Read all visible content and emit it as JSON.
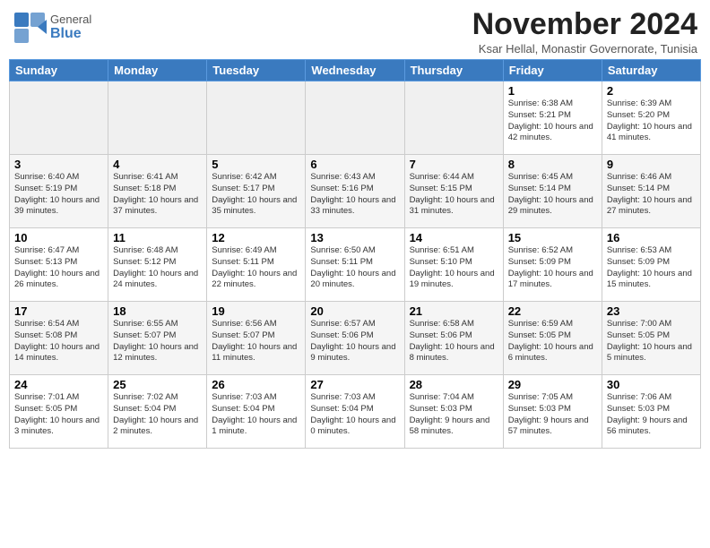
{
  "header": {
    "logo_general": "General",
    "logo_blue": "Blue",
    "month": "November 2024",
    "location": "Ksar Hellal, Monastir Governorate, Tunisia"
  },
  "days_of_week": [
    "Sunday",
    "Monday",
    "Tuesday",
    "Wednesday",
    "Thursday",
    "Friday",
    "Saturday"
  ],
  "weeks": [
    [
      {
        "day": "",
        "info": ""
      },
      {
        "day": "",
        "info": ""
      },
      {
        "day": "",
        "info": ""
      },
      {
        "day": "",
        "info": ""
      },
      {
        "day": "",
        "info": ""
      },
      {
        "day": "1",
        "info": "Sunrise: 6:38 AM\nSunset: 5:21 PM\nDaylight: 10 hours and 42 minutes."
      },
      {
        "day": "2",
        "info": "Sunrise: 6:39 AM\nSunset: 5:20 PM\nDaylight: 10 hours and 41 minutes."
      }
    ],
    [
      {
        "day": "3",
        "info": "Sunrise: 6:40 AM\nSunset: 5:19 PM\nDaylight: 10 hours and 39 minutes."
      },
      {
        "day": "4",
        "info": "Sunrise: 6:41 AM\nSunset: 5:18 PM\nDaylight: 10 hours and 37 minutes."
      },
      {
        "day": "5",
        "info": "Sunrise: 6:42 AM\nSunset: 5:17 PM\nDaylight: 10 hours and 35 minutes."
      },
      {
        "day": "6",
        "info": "Sunrise: 6:43 AM\nSunset: 5:16 PM\nDaylight: 10 hours and 33 minutes."
      },
      {
        "day": "7",
        "info": "Sunrise: 6:44 AM\nSunset: 5:15 PM\nDaylight: 10 hours and 31 minutes."
      },
      {
        "day": "8",
        "info": "Sunrise: 6:45 AM\nSunset: 5:14 PM\nDaylight: 10 hours and 29 minutes."
      },
      {
        "day": "9",
        "info": "Sunrise: 6:46 AM\nSunset: 5:14 PM\nDaylight: 10 hours and 27 minutes."
      }
    ],
    [
      {
        "day": "10",
        "info": "Sunrise: 6:47 AM\nSunset: 5:13 PM\nDaylight: 10 hours and 26 minutes."
      },
      {
        "day": "11",
        "info": "Sunrise: 6:48 AM\nSunset: 5:12 PM\nDaylight: 10 hours and 24 minutes."
      },
      {
        "day": "12",
        "info": "Sunrise: 6:49 AM\nSunset: 5:11 PM\nDaylight: 10 hours and 22 minutes."
      },
      {
        "day": "13",
        "info": "Sunrise: 6:50 AM\nSunset: 5:11 PM\nDaylight: 10 hours and 20 minutes."
      },
      {
        "day": "14",
        "info": "Sunrise: 6:51 AM\nSunset: 5:10 PM\nDaylight: 10 hours and 19 minutes."
      },
      {
        "day": "15",
        "info": "Sunrise: 6:52 AM\nSunset: 5:09 PM\nDaylight: 10 hours and 17 minutes."
      },
      {
        "day": "16",
        "info": "Sunrise: 6:53 AM\nSunset: 5:09 PM\nDaylight: 10 hours and 15 minutes."
      }
    ],
    [
      {
        "day": "17",
        "info": "Sunrise: 6:54 AM\nSunset: 5:08 PM\nDaylight: 10 hours and 14 minutes."
      },
      {
        "day": "18",
        "info": "Sunrise: 6:55 AM\nSunset: 5:07 PM\nDaylight: 10 hours and 12 minutes."
      },
      {
        "day": "19",
        "info": "Sunrise: 6:56 AM\nSunset: 5:07 PM\nDaylight: 10 hours and 11 minutes."
      },
      {
        "day": "20",
        "info": "Sunrise: 6:57 AM\nSunset: 5:06 PM\nDaylight: 10 hours and 9 minutes."
      },
      {
        "day": "21",
        "info": "Sunrise: 6:58 AM\nSunset: 5:06 PM\nDaylight: 10 hours and 8 minutes."
      },
      {
        "day": "22",
        "info": "Sunrise: 6:59 AM\nSunset: 5:05 PM\nDaylight: 10 hours and 6 minutes."
      },
      {
        "day": "23",
        "info": "Sunrise: 7:00 AM\nSunset: 5:05 PM\nDaylight: 10 hours and 5 minutes."
      }
    ],
    [
      {
        "day": "24",
        "info": "Sunrise: 7:01 AM\nSunset: 5:05 PM\nDaylight: 10 hours and 3 minutes."
      },
      {
        "day": "25",
        "info": "Sunrise: 7:02 AM\nSunset: 5:04 PM\nDaylight: 10 hours and 2 minutes."
      },
      {
        "day": "26",
        "info": "Sunrise: 7:03 AM\nSunset: 5:04 PM\nDaylight: 10 hours and 1 minute."
      },
      {
        "day": "27",
        "info": "Sunrise: 7:03 AM\nSunset: 5:04 PM\nDaylight: 10 hours and 0 minutes."
      },
      {
        "day": "28",
        "info": "Sunrise: 7:04 AM\nSunset: 5:03 PM\nDaylight: 9 hours and 58 minutes."
      },
      {
        "day": "29",
        "info": "Sunrise: 7:05 AM\nSunset: 5:03 PM\nDaylight: 9 hours and 57 minutes."
      },
      {
        "day": "30",
        "info": "Sunrise: 7:06 AM\nSunset: 5:03 PM\nDaylight: 9 hours and 56 minutes."
      }
    ]
  ]
}
